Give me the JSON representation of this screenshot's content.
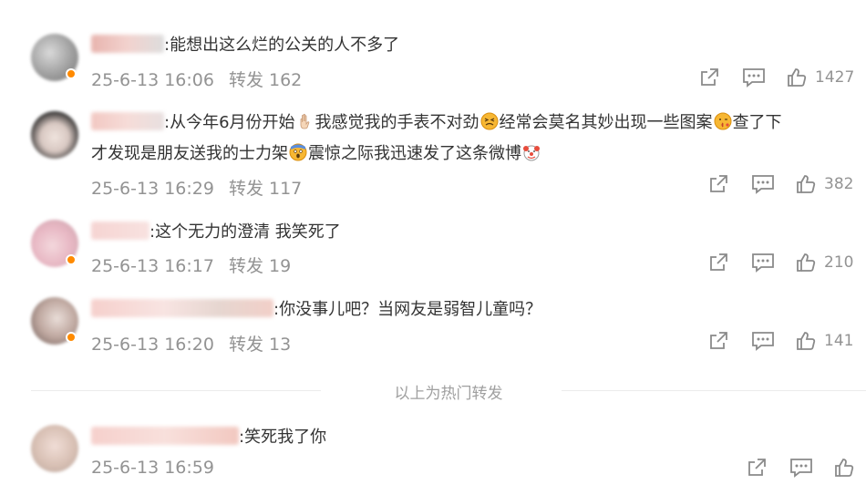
{
  "comments": [
    {
      "text": ":能想出这么烂的公关的人不多了",
      "date": "25-6-13 16:06",
      "repost": "转发 162",
      "likes": "1427"
    },
    {
      "text_a": ":从今年6月份开始",
      "text_b": "我感觉我的手表不对劲",
      "text_c": "经常会莫名其妙出现一些图案",
      "text_d": "查了下",
      "text2_a": "才发现是朋友送我的士力架",
      "text2_b": "震惊之际我迅速发了这条微博",
      "date": "25-6-13 16:29",
      "repost": "转发 117",
      "likes": "382"
    },
    {
      "text": ":这个无力的澄清 我笑死了",
      "date": "25-6-13 16:17",
      "repost": "转发 19",
      "likes": "210"
    },
    {
      "text": ":你没事儿吧？当网友是弱智儿童吗？",
      "date": "25-6-13 16:20",
      "repost": "转发 13",
      "likes": "141"
    }
  ],
  "divider_text": "以上为热门转发",
  "latest": {
    "text": ":笑死我了你",
    "date": "25-6-13 16:59"
  },
  "icons": {
    "repost": "share-out-icon",
    "comment": "comment-icon",
    "like": "thumbs-up-icon"
  },
  "colors": {
    "meta": "#939393",
    "text": "#333333",
    "badge": "#ff8a00"
  }
}
